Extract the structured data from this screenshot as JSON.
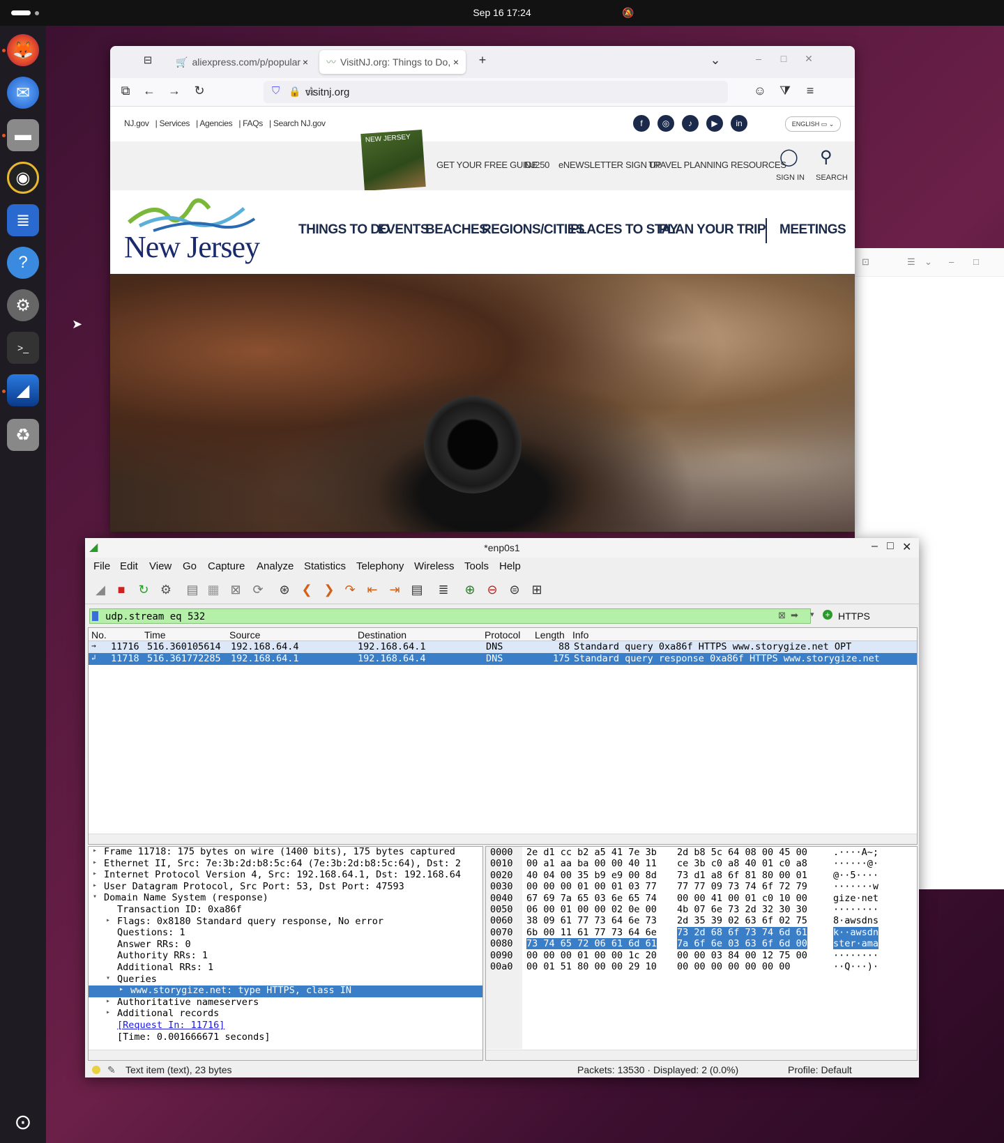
{
  "topbar": {
    "clock": "Sep 16  17:24"
  },
  "dock": {
    "items": [
      "firefox-icon",
      "thunderbird-icon",
      "files-icon",
      "rhythmbox-icon",
      "writer-icon",
      "help-icon",
      "settings-icon",
      "terminal-icon",
      "wireshark-icon",
      "trash-icon"
    ]
  },
  "firefox": {
    "tab1": "aliexpress.com/p/popular",
    "tab2": "VisitNJ.org: Things to Do,",
    "url": "visitnj.org",
    "site": {
      "util_links": [
        "NJ.gov",
        "| Services",
        "| Agencies",
        "| FAQs",
        "| Search NJ.gov"
      ],
      "lang": "ENGLISH",
      "guide_cover": "NEW JERSEY",
      "guide_links": [
        "GET YOUR FREE GUIDE",
        "NJ250",
        "eNEWSLETTER SIGN UP",
        "TRAVEL PLANNING RESOURCES"
      ],
      "sign_in": "SIGN IN",
      "search": "SEARCH",
      "logo": "New Jersey",
      "nav": [
        "THINGS TO DO",
        "EVENTS",
        "BEACHES",
        "REGIONS/CITIES",
        "PLACES TO STAY",
        "PLAN YOUR TRIP",
        "MEETINGS"
      ]
    }
  },
  "wireshark": {
    "title": "*enp0s1",
    "menu": [
      "File",
      "Edit",
      "View",
      "Go",
      "Capture",
      "Analyze",
      "Statistics",
      "Telephony",
      "Wireless",
      "Tools",
      "Help"
    ],
    "filter": "udp.stream eq 532",
    "filter_button": "HTTPS",
    "columns": [
      "No.",
      "Time",
      "Source",
      "Destination",
      "Protocol",
      "Length",
      "Info"
    ],
    "packets": [
      {
        "no": "11716",
        "time": "516.360105614",
        "src": "192.168.64.4",
        "dst": "192.168.64.1",
        "proto": "DNS",
        "len": "88",
        "info": "Standard query 0xa86f HTTPS www.storygize.net OPT"
      },
      {
        "no": "11718",
        "time": "516.361772285",
        "src": "192.168.64.1",
        "dst": "192.168.64.4",
        "proto": "DNS",
        "len": "175",
        "info": "Standard query response 0xa86f HTTPS www.storygize.net"
      }
    ],
    "details": [
      {
        "t": "Frame 11718: 175 bytes on wire (1400 bits), 175 bytes captured",
        "lvl": 0,
        "tw": "▸"
      },
      {
        "t": "Ethernet II, Src: 7e:3b:2d:b8:5c:64 (7e:3b:2d:b8:5c:64), Dst: 2",
        "lvl": 0,
        "tw": "▸"
      },
      {
        "t": "Internet Protocol Version 4, Src: 192.168.64.1, Dst: 192.168.64",
        "lvl": 0,
        "tw": "▸"
      },
      {
        "t": "User Datagram Protocol, Src Port: 53, Dst Port: 47593",
        "lvl": 0,
        "tw": "▸"
      },
      {
        "t": "Domain Name System (response)",
        "lvl": 0,
        "tw": "▾"
      },
      {
        "t": "Transaction ID: 0xa86f",
        "lvl": 1,
        "tw": ""
      },
      {
        "t": "Flags: 0x8180 Standard query response, No error",
        "lvl": 1,
        "tw": "▸"
      },
      {
        "t": "Questions: 1",
        "lvl": 1,
        "tw": ""
      },
      {
        "t": "Answer RRs: 0",
        "lvl": 1,
        "tw": ""
      },
      {
        "t": "Authority RRs: 1",
        "lvl": 1,
        "tw": ""
      },
      {
        "t": "Additional RRs: 1",
        "lvl": 1,
        "tw": ""
      },
      {
        "t": "Queries",
        "lvl": 1,
        "tw": "▾"
      },
      {
        "t": "www.storygize.net: type HTTPS, class IN",
        "lvl": 2,
        "tw": "▸"
      },
      {
        "t": "Authoritative nameservers",
        "lvl": 1,
        "tw": "▸"
      },
      {
        "t": "Additional records",
        "lvl": 1,
        "tw": "▸"
      },
      {
        "t": "[Request In: 11716]",
        "lvl": 1,
        "tw": ""
      },
      {
        "t": "[Time: 0.001666671 seconds]",
        "lvl": 1,
        "tw": ""
      }
    ],
    "bytes": [
      {
        "off": "0000",
        "h1": "2e d1 cc b2 a5 41 7e 3b",
        "h2": "2d b8 5c 64 08 00 45 00",
        "a": ".····A~;"
      },
      {
        "off": "0010",
        "h1": "00 a1 aa ba 00 00 40 11",
        "h2": "ce 3b c0 a8 40 01 c0 a8",
        "a": "······@·"
      },
      {
        "off": "0020",
        "h1": "40 04 00 35 b9 e9 00 8d",
        "h2": "73 d1 a8 6f 81 80 00 01",
        "a": "@··5····"
      },
      {
        "off": "0030",
        "h1": "00 00 00 01 00 01 03 77",
        "h2": "77 77 09 73 74 6f 72 79",
        "a": "·······w"
      },
      {
        "off": "0040",
        "h1": "67 69 7a 65 03 6e 65 74",
        "h2": "00 00 41 00 01 c0 10 00",
        "a": "gize·net"
      },
      {
        "off": "0050",
        "h1": "06 00 01 00 00 02 0e 00",
        "h2": "4b 07 6e 73 2d 32 30 30",
        "a": "········"
      },
      {
        "off": "0060",
        "h1": "38 09 61 77 73 64 6e 73",
        "h2": "2d 35 39 02 63 6f 02 75",
        "a": "8·awsdns"
      },
      {
        "off": "0070",
        "h1": "6b 00 11 61 77 73 64 6e",
        "h2": "73 2d 68 6f 73 74 6d 61",
        "a": "k··awsdn"
      },
      {
        "off": "0080",
        "h1": "73 74 65 72 06 61 6d 61",
        "h2": "7a 6f 6e 03 63 6f 6d 00",
        "a": "ster·ama"
      },
      {
        "off": "0090",
        "h1": "00 00 00 01 00 00 1c 20",
        "h2": "00 00 03 84 00 12 75 00",
        "a": "········"
      },
      {
        "off": "00a0",
        "h1": "00 01 51 80 00 00 29 10",
        "h2": "00 00 00 00 00 00 00",
        "a": "··Q···)·"
      }
    ],
    "status_text": "Text item (text), 23 bytes",
    "status_packets": "Packets: 13530 · Displayed: 2 (0.0%)",
    "status_profile": "Profile: Default"
  }
}
